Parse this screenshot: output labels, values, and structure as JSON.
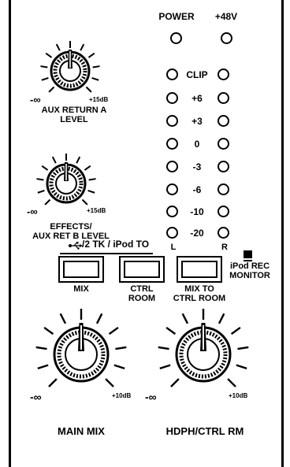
{
  "power": {
    "power_label": "POWER",
    "phantom_label": "+48V"
  },
  "aux_a": {
    "min": "-∞",
    "max": "+15dB",
    "label_line1": "AUX RETURN A",
    "label_line2": "LEVEL"
  },
  "effects": {
    "min": "-∞",
    "max": "+15dB",
    "label_line1": "EFFECTS/",
    "label_line2": "AUX RET B LEVEL"
  },
  "meter": {
    "levels": [
      "CLIP",
      "+6",
      "+3",
      "0",
      "-3",
      "-6",
      "-10",
      "-20"
    ],
    "left_label": "L",
    "right_label": "R"
  },
  "routing": {
    "header": "/2 TK / iPod TO",
    "mix": "MIX",
    "ctrl_line1": "CTRL",
    "ctrl_line2": "ROOM",
    "mix_to_line1": "MIX TO",
    "mix_to_line2": "CTRL ROOM",
    "ipod_line1": "iPod REC",
    "ipod_line2": "MONITOR"
  },
  "main_mix": {
    "min": "-∞",
    "max": "+10dB",
    "label": "MAIN MIX"
  },
  "hdph": {
    "min": "-∞",
    "max": "+10dB",
    "label": "HDPH/CTRL RM"
  }
}
